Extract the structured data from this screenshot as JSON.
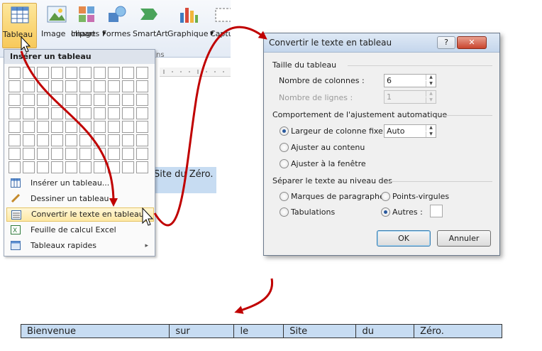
{
  "ribbon": {
    "buttons": [
      {
        "label": "Tableau"
      },
      {
        "label": "Image"
      },
      {
        "label": "Images",
        "label2": "clipart"
      },
      {
        "label": "Formes"
      },
      {
        "label": "SmartArt"
      },
      {
        "label": "Graphique"
      },
      {
        "label": "Captu"
      }
    ],
    "group_label_fragment": "ns"
  },
  "menu": {
    "header": "Insérer un tableau",
    "items": [
      {
        "label": "Insérer un tableau..."
      },
      {
        "label": "Dessiner un tableau"
      },
      {
        "label": "Convertir le texte en tableau..."
      },
      {
        "label": "Feuille de calcul Excel"
      },
      {
        "label": "Tableaux rapides"
      }
    ],
    "submenu_arrow": "▸"
  },
  "document": {
    "selected_text": "Site du Zéro."
  },
  "dialog": {
    "title": "Convertir le texte en tableau",
    "help_button": "?",
    "close_button": "✕",
    "section_size": "Taille du tableau",
    "columns_label": "Nombre de colonnes :",
    "columns_value": "6",
    "rows_label": "Nombre de lignes :",
    "rows_value": "1",
    "section_autofit": "Comportement de l'ajustement automatique",
    "autofit_fixed": "Largeur de colonne fixe :",
    "autofit_fixed_value": "Auto",
    "autofit_contents": "Ajuster au contenu",
    "autofit_window": "Ajuster à la fenêtre",
    "section_separate": "Séparer le texte au niveau des",
    "sep_paragraphs": "Marques de paragraphe",
    "sep_semicolons": "Points-virgules",
    "sep_tabs": "Tabulations",
    "sep_other": "Autres :",
    "ok": "OK",
    "cancel": "Annuler"
  },
  "result_table": {
    "cells": [
      "Bienvenue",
      "sur",
      "le",
      "Site",
      "du",
      "Zéro."
    ]
  },
  "colors": {
    "arrow": "#c00000",
    "selection": "#c7dcf2",
    "highlight": "#fde8a4"
  }
}
